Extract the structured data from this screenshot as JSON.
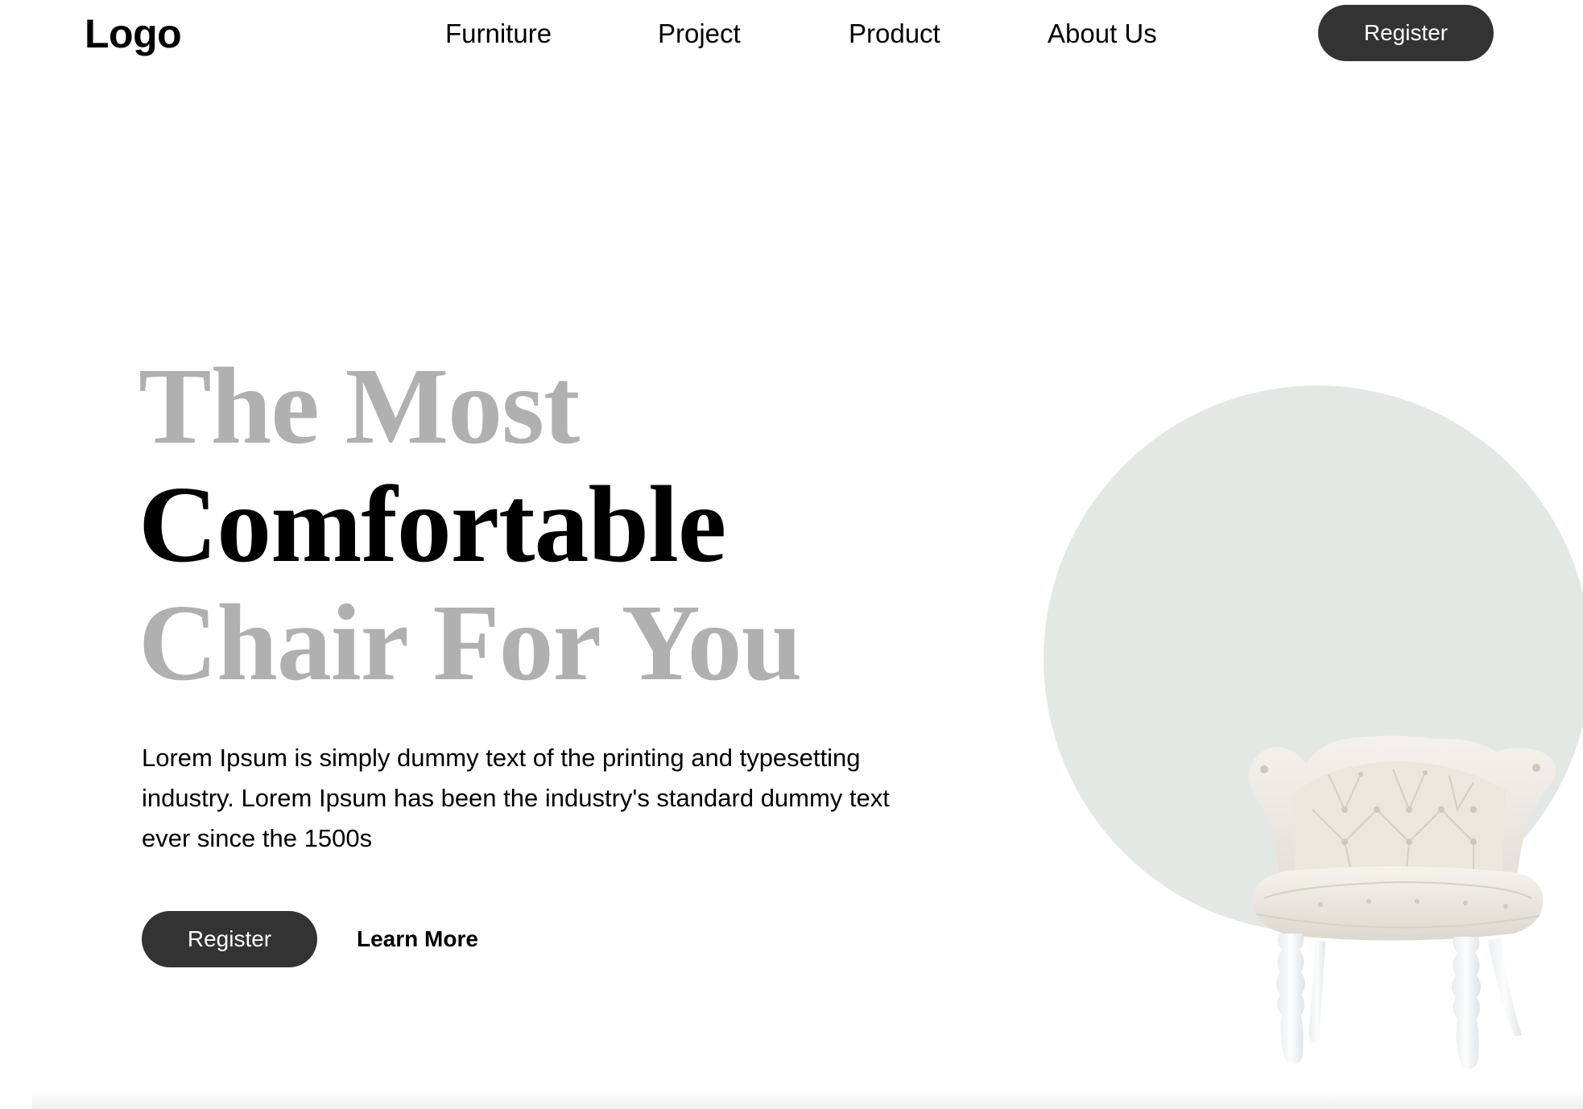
{
  "nav": {
    "logo": "Logo",
    "links": [
      "Furniture",
      "Project",
      "Product",
      "About Us"
    ],
    "register_label": "Register"
  },
  "hero": {
    "title_line_1": "The Most",
    "title_line_2": "Comfortable",
    "title_line_3": "Chair For You",
    "description": "Lorem Ipsum is simply dummy text of the printing and typesetting industry. Lorem Ipsum has been the industry's standard dummy text ever since the 1500s",
    "register_label": "Register",
    "learn_more_label": "Learn More"
  },
  "colors": {
    "button_dark": "#333333",
    "title_muted": "#b0b0b0",
    "title_strong": "#000000",
    "circle_bg": "#e4e8e5",
    "chair_fabric": "#eeeae4",
    "chair_legs": "#f3f5f6"
  }
}
